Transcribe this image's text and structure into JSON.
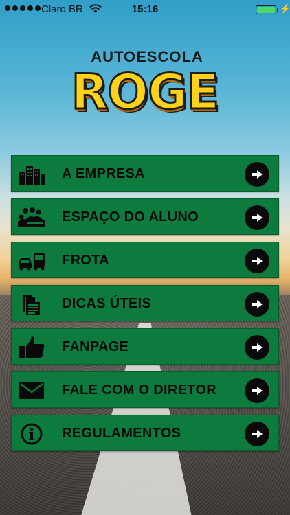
{
  "status_bar": {
    "carrier": "Claro BR",
    "time": "15:16",
    "battery_level": 1.0
  },
  "logo": {
    "sub": "AUTOESCOLA",
    "main": "ROGE"
  },
  "colors": {
    "button_green": "#0d7a3e",
    "label_black": "#0a0a0a",
    "logo_yellow": "#ffd21a"
  },
  "menu": {
    "items": [
      {
        "label": "A EMPRESA",
        "icon": "buildings-icon"
      },
      {
        "label": "ESPAÇO DO ALUNO",
        "icon": "students-icon"
      },
      {
        "label": "FROTA",
        "icon": "vehicles-icon"
      },
      {
        "label": "DICAS ÚTEIS",
        "icon": "documents-icon"
      },
      {
        "label": "FANPAGE",
        "icon": "thumbs-up-icon"
      },
      {
        "label": "FALE COM O DIRETOR",
        "icon": "envelope-icon"
      },
      {
        "label": "REGULAMENTOS",
        "icon": "info-icon"
      }
    ]
  }
}
